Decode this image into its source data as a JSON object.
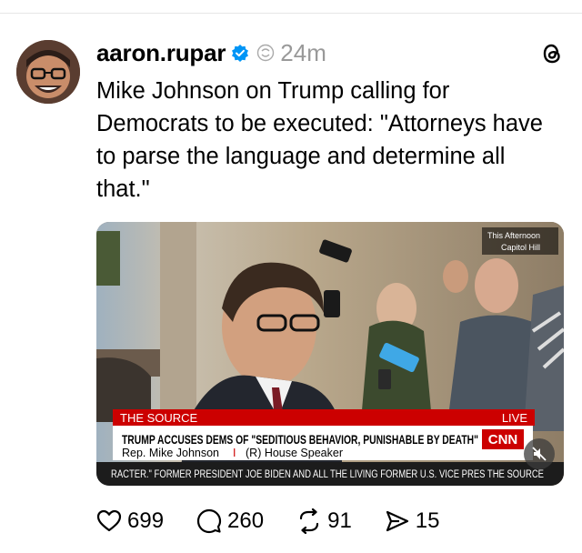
{
  "post": {
    "username": "aaron.rupar",
    "timestamp": "24m",
    "text": "Mike Johnson on Trump calling for Democrats to be executed: \"Attorneys have to parse the language and determine all that.\""
  },
  "media": {
    "corner_label_line1": "This Afternoon",
    "corner_label_line2": "Capitol Hill",
    "tag_left": "THE SOURCE",
    "tag_right": "LIVE",
    "headline": "TRUMP ACCUSES DEMS OF \"SEDITIOUS BEHAVIOR, PUNISHABLE BY DEATH\"",
    "network": "CNN",
    "lower_third_name": "Rep. Mike Johnson",
    "lower_third_sep": "I",
    "lower_third_role": "(R) House Speaker",
    "ticker": "RACTER.\" FORMER PRESIDENT JOE BIDEN AND ALL THE LIVING FORMER U.S. VICE PRES  THE SOURCE"
  },
  "actions": {
    "likes": "699",
    "replies": "260",
    "reposts": "91",
    "shares": "15"
  },
  "colors": {
    "verified": "#0095f6",
    "cnn_red": "#cc0000",
    "timestamp": "#999999"
  },
  "icons": [
    "verified-badge-icon",
    "repost-mini-icon",
    "threads-logo-icon",
    "mute-icon",
    "heart-icon",
    "comment-icon",
    "repost-icon",
    "share-icon"
  ]
}
